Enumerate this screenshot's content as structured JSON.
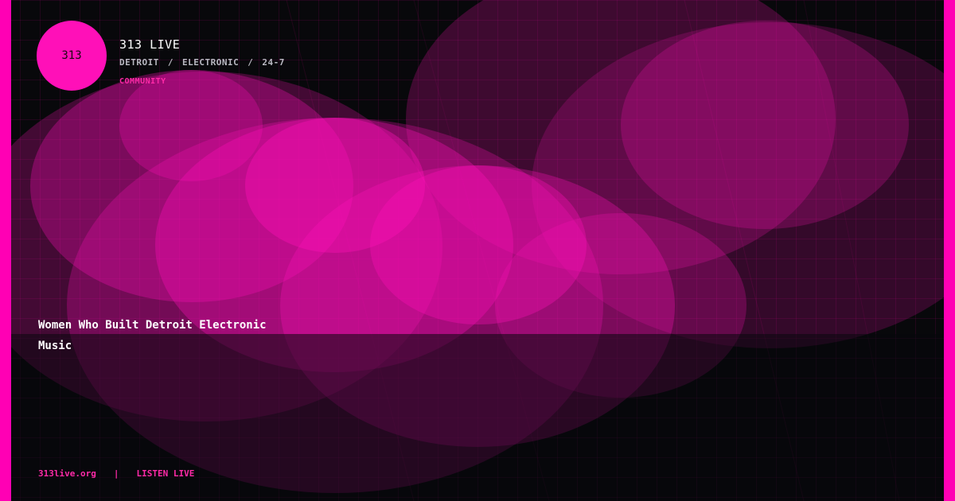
{
  "brand": {
    "logo_text": "313",
    "station_name": "313 LIVE",
    "accent_color": "#ff10b8"
  },
  "tagline": {
    "parts": [
      "DETROIT",
      "ELECTRONIC",
      "24-7"
    ],
    "separator": "/"
  },
  "category": "COMMUNITY",
  "headline": "Women Who Built Detroit Electronic Music",
  "footer": {
    "site": "313live.org",
    "divider": "|",
    "cta": "LISTEN LIVE"
  }
}
